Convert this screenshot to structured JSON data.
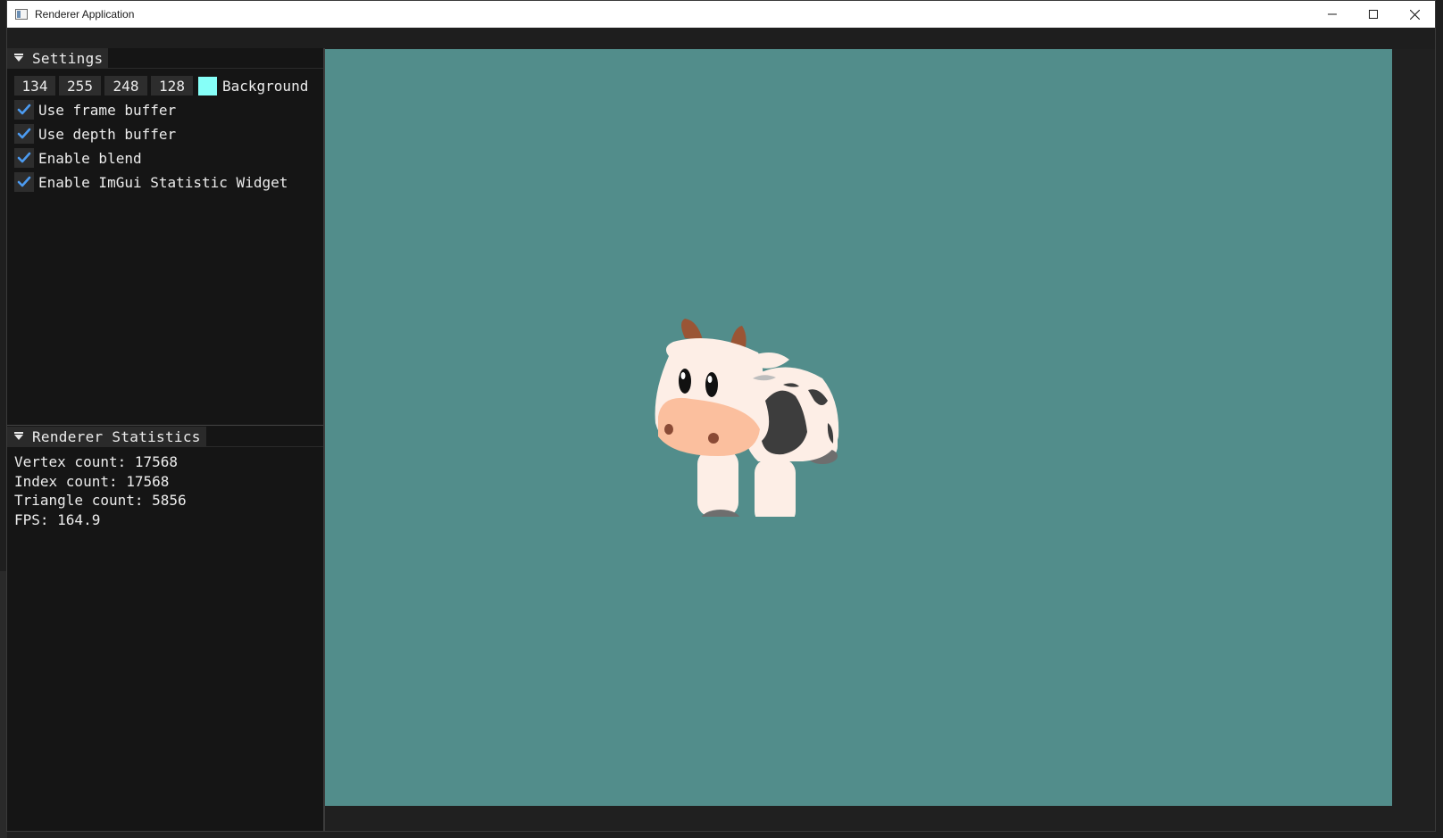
{
  "window": {
    "title": "Renderer Application",
    "controls": {
      "minimize": "minimize-icon",
      "maximize": "maximize-icon",
      "close": "close-icon"
    }
  },
  "settings": {
    "title": "Settings",
    "background_color": {
      "r": "134",
      "g": "255",
      "b": "248",
      "a": "128",
      "swatch_color": "#86fff8",
      "label": "Background"
    },
    "checkboxes": [
      {
        "label": "Use frame buffer",
        "checked": true
      },
      {
        "label": "Use depth buffer",
        "checked": true
      },
      {
        "label": "Enable blend",
        "checked": true
      },
      {
        "label": "Enable ImGui Statistic Widget",
        "checked": true
      }
    ]
  },
  "statistics": {
    "title": "Renderer Statistics",
    "lines": [
      "Vertex count: 17568",
      "Index count: 17568",
      "Triangle count: 5856",
      "FPS: 164.9"
    ]
  },
  "viewport": {
    "clear_color": "#528d8b",
    "model": "cow"
  },
  "colors": {
    "accent_check": "#4c9bf0",
    "panel_bg": "#151515"
  }
}
